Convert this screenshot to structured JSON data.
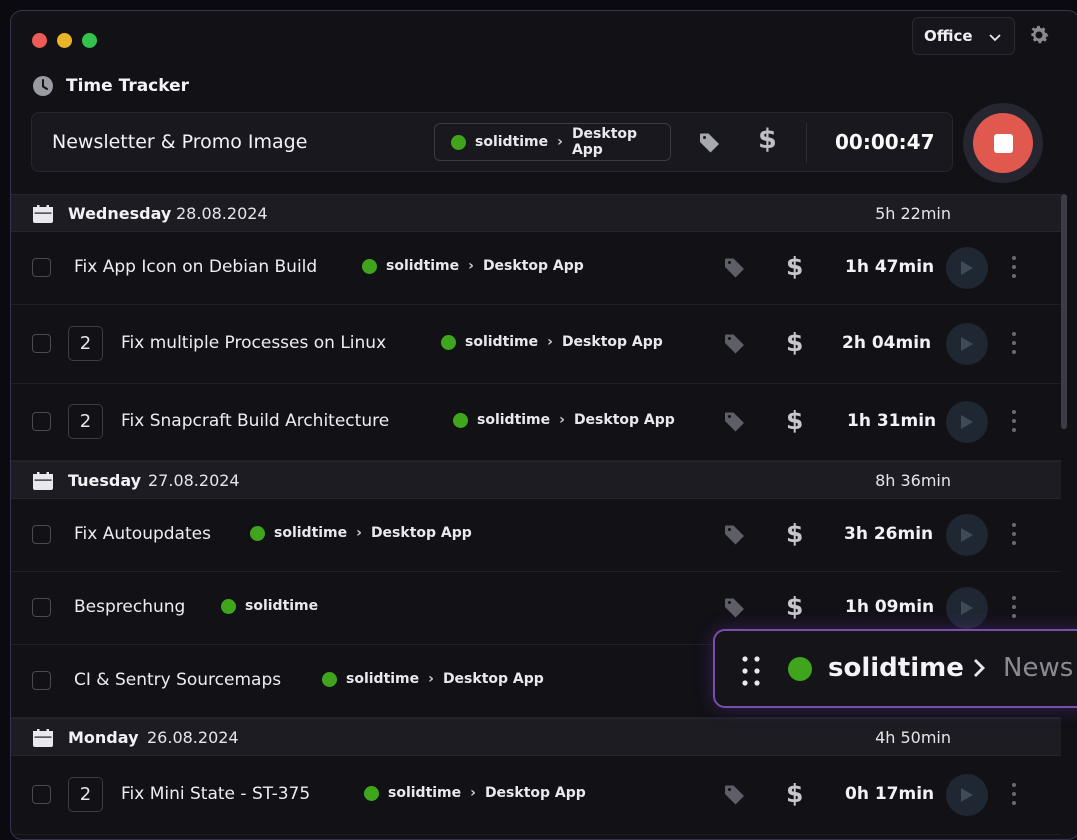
{
  "header": {
    "org": "Office"
  },
  "tracker": {
    "title": "Time Tracker",
    "description": "Newsletter & Promo Image",
    "project": "solidtime",
    "subproject": "Desktop App",
    "timer": "00:00:47"
  },
  "days": [
    {
      "name": "Wednesday",
      "date": "28.08.2024",
      "total": "5h 22min",
      "entries": [
        {
          "count": "",
          "desc": "Fix App Icon on Debian Build",
          "project": "solidtime",
          "subproject": "Desktop App",
          "duration": "1h 47min"
        },
        {
          "count": "2",
          "desc": "Fix multiple Processes on Linux",
          "project": "solidtime",
          "subproject": "Desktop App",
          "duration": "2h 04min"
        },
        {
          "count": "2",
          "desc": "Fix Snapcraft Build Architecture",
          "project": "solidtime",
          "subproject": "Desktop App",
          "duration": "1h 31min"
        }
      ]
    },
    {
      "name": "Tuesday",
      "date": "27.08.2024",
      "total": "8h 36min",
      "entries": [
        {
          "count": "",
          "desc": "Fix Autoupdates",
          "project": "solidtime",
          "subproject": "Desktop App",
          "duration": "3h 26min"
        },
        {
          "count": "",
          "desc": "Besprechung",
          "project": "solidtime",
          "subproject": "",
          "duration": "1h 09min"
        },
        {
          "count": "",
          "desc": "CI & Sentry Sourcemaps",
          "project": "solidtime",
          "subproject": "Desktop App",
          "duration": ""
        }
      ]
    },
    {
      "name": "Monday",
      "date": "26.08.2024",
      "total": "4h 50min",
      "entries": [
        {
          "count": "2",
          "desc": "Fix Mini State - ST-375",
          "project": "solidtime",
          "subproject": "Desktop App",
          "duration": "0h 17min"
        }
      ]
    }
  ],
  "mini": {
    "project": "solidtime",
    "desc": "News"
  },
  "colors": {
    "project_dot": "#3fa51d",
    "stop": "#e0584e",
    "accent_border": "#7a4ea8"
  },
  "icons": [
    "clock-icon",
    "gear-icon",
    "chevron-down-icon",
    "tag-icon",
    "dollar-icon",
    "calendar-icon",
    "play-icon",
    "kebab-icon",
    "grip-icon",
    "stop-icon"
  ],
  "glyphs": {
    "sep": "›",
    "dollar": "$"
  }
}
